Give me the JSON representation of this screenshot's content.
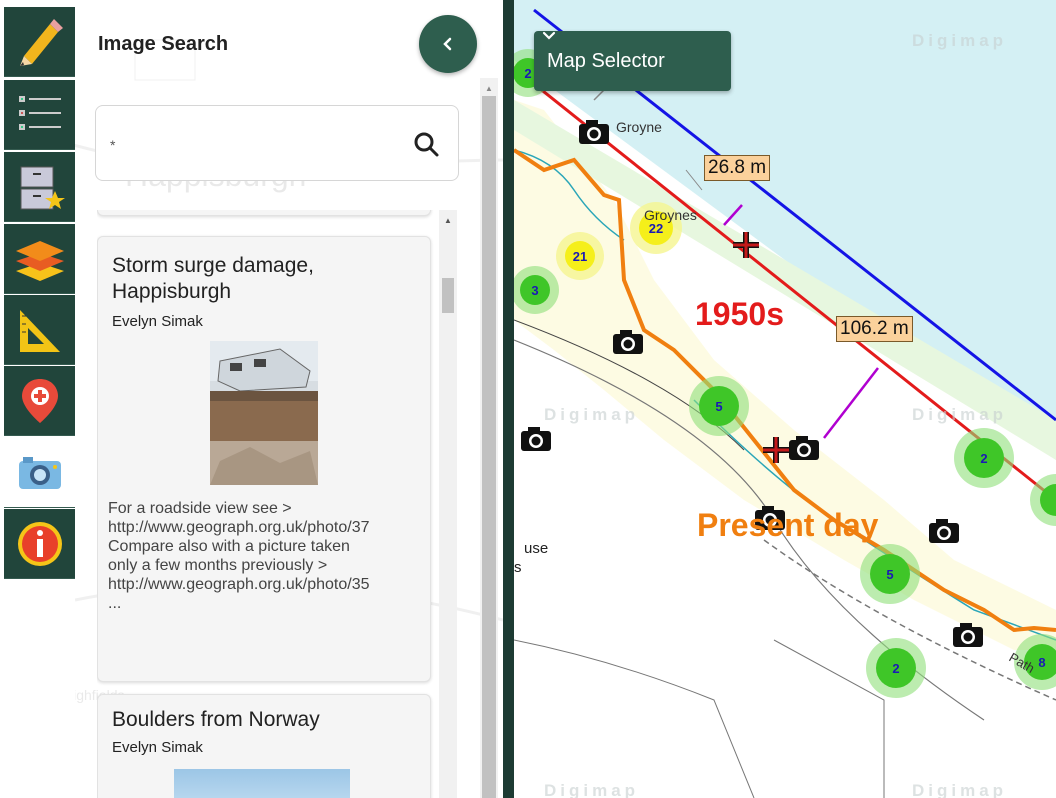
{
  "panel": {
    "title": "Image Search",
    "search_value": "*"
  },
  "results": [
    {
      "title": "Storm surge damage, Happisburgh",
      "author": "Evelyn Simak",
      "description": "For a roadside view see >\nhttp://www.geograph.org.uk/photo/37\nCompare also with a picture taken\nonly a few months previously >\nhttp://www.geograph.org.uk/photo/35\n..."
    },
    {
      "title": "Boulders from Norway",
      "author": "Evelyn Simak"
    }
  ],
  "map": {
    "selector_label": "Map Selector",
    "measurements": [
      "26.8 m",
      "106.2 m"
    ],
    "labels": {
      "era_1": "1950s",
      "era_2": "Present day"
    },
    "clusters": [
      "2",
      "22",
      "21",
      "3",
      "5",
      "2",
      "5",
      "2",
      "8"
    ],
    "place_labels": [
      "Groyne",
      "Groynes",
      "use",
      "s",
      "Path"
    ],
    "background_labels": [
      "Happisburgh",
      "lighfields"
    ],
    "watermark": "Digimap"
  },
  "colors": {
    "toolbar": "#21453b",
    "accent": "#2e5e4e",
    "line_1950s": "#e31b1b",
    "line_present": "#f07f10",
    "line_blue": "#1414e6",
    "sea": "#d4f0f4",
    "land": "#fdfbe3"
  },
  "icons": [
    "pencil-icon",
    "list-icon",
    "saved-items-icon",
    "layers-icon",
    "measure-icon",
    "map-pin-icon",
    "camera-icon",
    "info-icon",
    "search-icon",
    "chevron-left-icon",
    "chevron-down-icon"
  ]
}
